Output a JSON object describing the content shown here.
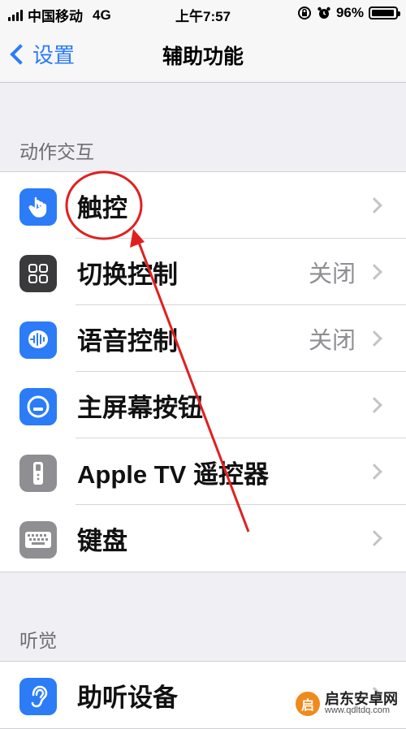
{
  "status_bar": {
    "carrier": "中国移动",
    "network": "4G",
    "time": "上午7:57",
    "battery": "96%",
    "battery_level": 0.96
  },
  "nav": {
    "back_label": "设置",
    "title": "辅助功能"
  },
  "sections": {
    "interaction": {
      "header": "动作交互",
      "items": [
        {
          "label": "触控",
          "value": "",
          "icon": "hand-touch-icon",
          "icon_color": "#2b7cf6"
        },
        {
          "label": "切换控制",
          "value": "关闭",
          "icon": "switch-grid-icon",
          "icon_color": "#3a3a3c"
        },
        {
          "label": "语音控制",
          "value": "关闭",
          "icon": "voice-control-icon",
          "icon_color": "#2b7cf6"
        },
        {
          "label": "主屏幕按钮",
          "value": "",
          "icon": "home-button-icon",
          "icon_color": "#2b7cf6"
        },
        {
          "label": "Apple TV 遥控器",
          "value": "",
          "icon": "tv-remote-icon",
          "icon_color": "#8e8e93"
        },
        {
          "label": "键盘",
          "value": "",
          "icon": "keyboard-icon",
          "icon_color": "#8e8e93"
        }
      ]
    },
    "hearing": {
      "header": "听觉",
      "items": [
        {
          "label": "助听设备",
          "value": "",
          "icon": "ear-icon",
          "icon_color": "#2b7cf6"
        }
      ]
    }
  },
  "annotation": {
    "color": "#e02020"
  },
  "watermark": {
    "name": "启东安卓网",
    "url": "www.qdltdq.com",
    "logo_char": "启"
  }
}
